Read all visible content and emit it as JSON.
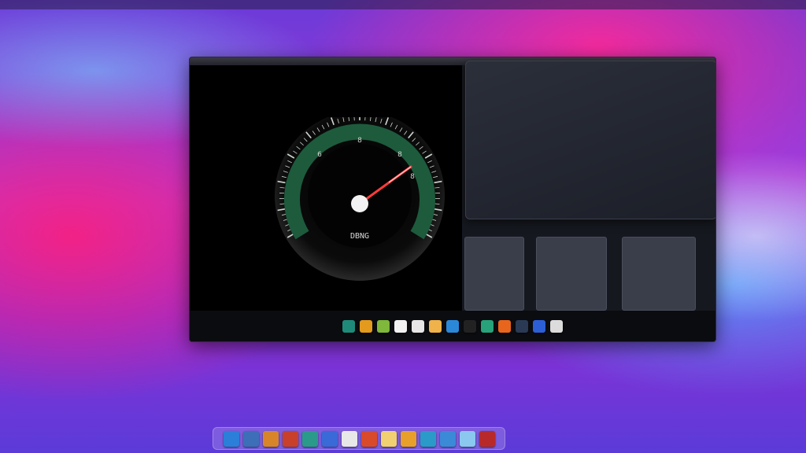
{
  "menubar": {
    "left_items": [
      "",
      "",
      "",
      "",
      "",
      "",
      "",
      ""
    ],
    "right_items": [
      "",
      "",
      "",
      ""
    ]
  },
  "window": {
    "title": ""
  },
  "gauge": {
    "tick_labels": [
      "6",
      "8",
      "8",
      "8"
    ],
    "readout": "DBNG",
    "sub_label": ""
  },
  "info_card": {
    "title": "",
    "lines": [
      "",
      "",
      "",
      "",
      "",
      ""
    ]
  },
  "tiles": [
    {
      "lines": []
    },
    {
      "lines": [
        "",
        "",
        "",
        ""
      ]
    },
    {
      "lines": [
        "",
        "",
        "",
        ""
      ]
    }
  ],
  "window_dock": {
    "icons": [
      {
        "name": "app-icon-1",
        "color": "#1f8a7a"
      },
      {
        "name": "app-icon-2",
        "color": "#e39a1d"
      },
      {
        "name": "app-icon-3",
        "color": "#7fb83a"
      },
      {
        "name": "app-icon-4",
        "color": "#f2f2f2"
      },
      {
        "name": "app-icon-5",
        "color": "#e6e6e6"
      },
      {
        "name": "app-icon-6",
        "color": "#f0b24a"
      },
      {
        "name": "app-icon-7",
        "color": "#2b88d8"
      },
      {
        "name": "app-icon-8",
        "color": "#222222"
      },
      {
        "name": "app-icon-9",
        "color": "#27a27a"
      },
      {
        "name": "app-icon-10",
        "color": "#e8651e"
      },
      {
        "name": "app-icon-11",
        "color": "#2a3a55"
      },
      {
        "name": "app-icon-12",
        "color": "#2c5fd6"
      },
      {
        "name": "app-icon-13",
        "color": "#dcdcdc"
      }
    ]
  },
  "main_dock": {
    "icons": [
      {
        "name": "finder-icon",
        "color": "#2b7fd8"
      },
      {
        "name": "app-icon-b",
        "color": "#3c6fb8"
      },
      {
        "name": "app-icon-c",
        "color": "#d8852a"
      },
      {
        "name": "app-icon-d",
        "color": "#c8402a"
      },
      {
        "name": "app-icon-e",
        "color": "#2a9a8a"
      },
      {
        "name": "app-icon-f",
        "color": "#3a6ad8"
      },
      {
        "name": "app-icon-g",
        "color": "#e8e8e8"
      },
      {
        "name": "app-icon-h",
        "color": "#d84a2a"
      },
      {
        "name": "app-icon-i",
        "color": "#f0d070"
      },
      {
        "name": "app-icon-j",
        "color": "#e8a02a"
      },
      {
        "name": "app-icon-k",
        "color": "#2a9ac8"
      },
      {
        "name": "app-icon-l",
        "color": "#3a8ad8"
      },
      {
        "name": "app-icon-m",
        "color": "#8ac8f0"
      },
      {
        "name": "trash-icon",
        "color": "#b82a2a"
      }
    ]
  },
  "colors": {
    "gauge_ring": "#1d5b3c",
    "needle": "#ff3b3b",
    "title_accent": "#9fe6e6"
  }
}
